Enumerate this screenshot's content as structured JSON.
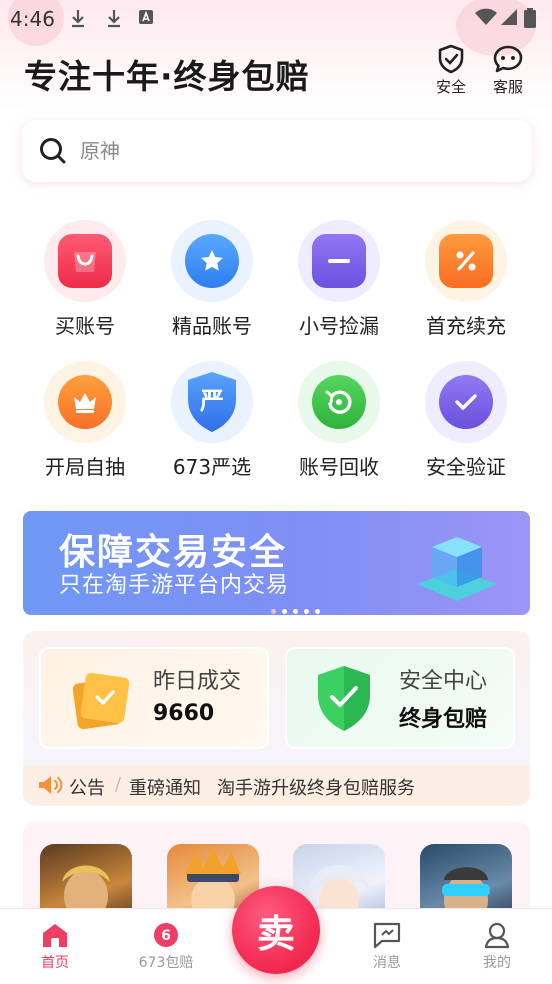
{
  "status_bar": {
    "time": "4:46"
  },
  "header": {
    "title": "专注十年·终身包赔",
    "security_label": "安全",
    "service_label": "客服"
  },
  "search": {
    "placeholder": "原神"
  },
  "grid": [
    {
      "label": "买账号",
      "icon": "shopping-bag-icon",
      "color": "#f0304f"
    },
    {
      "label": "精品账号",
      "icon": "star-icon",
      "color": "#3a8ff6"
    },
    {
      "label": "小号捡漏",
      "icon": "minus-icon",
      "color": "#7a62e8"
    },
    {
      "label": "首充续充",
      "icon": "percent-icon",
      "color": "#fb7b2c"
    },
    {
      "label": "开局自抽",
      "icon": "crown-icon",
      "color": "#fb7e2a"
    },
    {
      "label": "673严选",
      "icon": "shield-icon",
      "color": "#3f7ff2"
    },
    {
      "label": "账号回收",
      "icon": "recycle-icon",
      "color": "#36c04a"
    },
    {
      "label": "安全验证",
      "icon": "check-icon",
      "color": "#7c62e6"
    }
  ],
  "banner": {
    "title": "保障交易安全",
    "subtitle": "只在淘手游平台内交易",
    "dot_count": 5,
    "active_dot": 0
  },
  "stats": {
    "yesterday_label": "昨日成交",
    "yesterday_value": "9660",
    "security_center_label": "安全中心",
    "security_center_value": "终身包赔"
  },
  "notice": {
    "tag": "公告",
    "separator": "/",
    "category": "重磅通知",
    "text": "淘手游升级终身包赔服务"
  },
  "bottom_nav": {
    "home": "首页",
    "compensation": "673包赔",
    "sell": "卖",
    "messages": "消息",
    "mine": "我的"
  },
  "colors": {
    "accent": "#ef3d64",
    "banner_start": "#6f98f5",
    "banner_end": "#9b95f6"
  }
}
